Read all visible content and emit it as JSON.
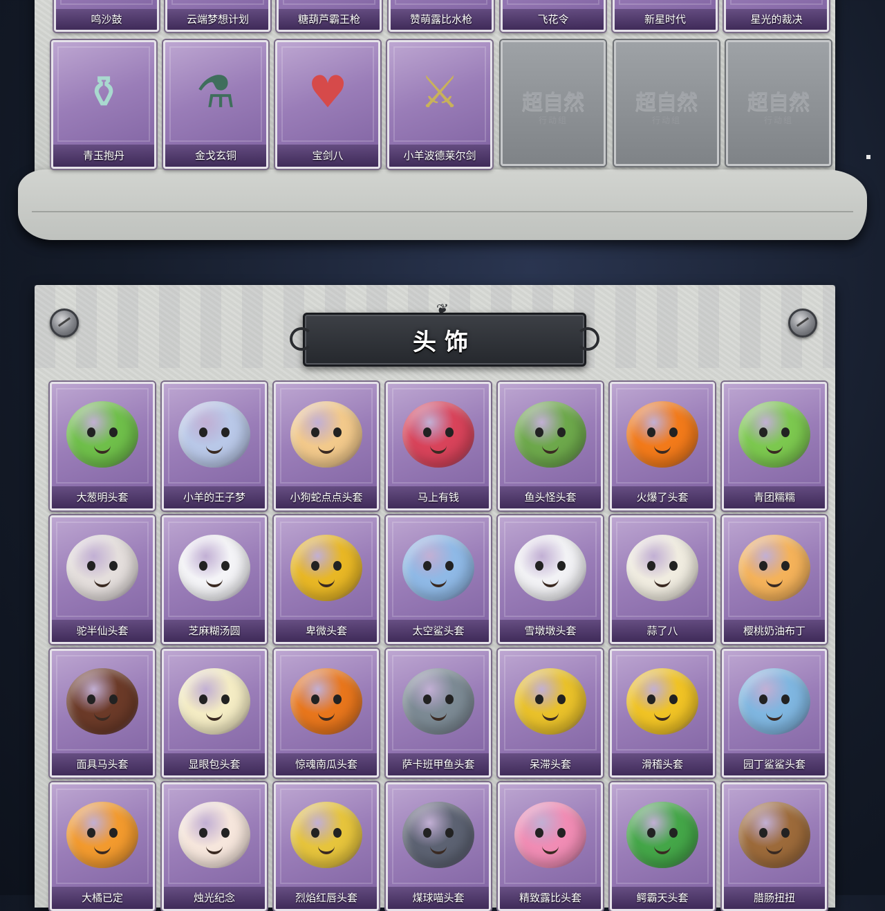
{
  "top_section": {
    "row1_labels": [
      "鸣沙鼓",
      "云端梦想计划",
      "糖葫芦霸王枪",
      "赞萌露比水枪",
      "飞花令",
      "新星时代",
      "星光的裁决"
    ],
    "row2_items": [
      {
        "label": "青玉抱丹",
        "icon": "jade-gourd-icon",
        "color": "#a9d9cf"
      },
      {
        "label": "金戈玄铜",
        "icon": "bronze-grenade-icon",
        "color": "#3f6e5c"
      },
      {
        "label": "宝剑八",
        "icon": "heart-shield-icon",
        "color": "#d64a4a"
      },
      {
        "label": "小羊波德莱尔剑",
        "icon": "sword-icon",
        "color": "#c9b25a"
      }
    ],
    "locked_cards": [
      {
        "text": "超自然",
        "sub": "行动组"
      },
      {
        "text": "超自然",
        "sub": "行动组"
      },
      {
        "text": "超自然",
        "sub": "行动组"
      }
    ]
  },
  "section_title": "头饰",
  "headwear": [
    [
      {
        "label": "大葱明头套",
        "icon": "scallion-head-icon",
        "color": "#6fbf4a"
      },
      {
        "label": "小羊的王子梦",
        "icon": "sheep-crown-head-icon",
        "color": "#b9c8e8"
      },
      {
        "label": "小狗蛇点点头套",
        "icon": "snake-head-icon",
        "color": "#f2c98b"
      },
      {
        "label": "马上有钱",
        "icon": "red-horse-head-icon",
        "color": "#d8435a"
      },
      {
        "label": "鱼头怪头套",
        "icon": "fish-head-icon",
        "color": "#6da84b"
      },
      {
        "label": "火爆了头套",
        "icon": "fire-head-icon",
        "color": "#f27a1a"
      },
      {
        "label": "青团糯糯",
        "icon": "green-dumpling-head-icon",
        "color": "#7cc84f"
      }
    ],
    [
      {
        "label": "驼半仙头套",
        "icon": "alpaca-sunglasses-head-icon",
        "color": "#e4dedc"
      },
      {
        "label": "芝麻糊汤圆",
        "icon": "rice-ball-head-icon",
        "color": "#f4f4f7"
      },
      {
        "label": "卑微头套",
        "icon": "sad-emoji-head-icon",
        "color": "#e8b725"
      },
      {
        "label": "太空鲨头套",
        "icon": "shark-head-icon",
        "color": "#8fb9e6"
      },
      {
        "label": "雪墩墩头套",
        "icon": "snowman-head-icon",
        "color": "#f2f2f5"
      },
      {
        "label": "蒜了八",
        "icon": "garlic-head-icon",
        "color": "#f0ece0"
      },
      {
        "label": "樱桃奶油布丁",
        "icon": "pudding-head-icon",
        "color": "#f4b25a"
      }
    ],
    [
      {
        "label": "面具马头套",
        "icon": "horse-mask-head-icon",
        "color": "#6b3a28"
      },
      {
        "label": "显眼包头套",
        "icon": "lightbulb-head-icon",
        "color": "#f4ecc4"
      },
      {
        "label": "惊魂南瓜头套",
        "icon": "pumpkin-head-icon",
        "color": "#e8761c"
      },
      {
        "label": "萨卡班甲鱼头套",
        "icon": "sacabambaspis-head-icon",
        "color": "#7c8a94"
      },
      {
        "label": "呆滞头套",
        "icon": "dazed-emoji-head-icon",
        "color": "#e9c12a"
      },
      {
        "label": "滑稽头套",
        "icon": "funny-emoji-head-icon",
        "color": "#f0c325"
      },
      {
        "label": "园丁鲨鲨头套",
        "icon": "gardener-shark-head-icon",
        "color": "#7fb6e0"
      }
    ],
    [
      {
        "label": "大橘已定",
        "icon": "orange-slice-head-icon",
        "color": "#f29a2e"
      },
      {
        "label": "烛光纪念",
        "icon": "candle-head-icon",
        "color": "#f6e6dc"
      },
      {
        "label": "烈焰红唇头套",
        "icon": "pikachu-sunglasses-head-icon",
        "color": "#e6c43c"
      },
      {
        "label": "煤球喵头套",
        "icon": "gray-cat-head-icon",
        "color": "#5c6272"
      },
      {
        "label": "精致露比头套",
        "icon": "pink-beaver-head-icon",
        "color": "#f08cb4"
      },
      {
        "label": "鳄霸天头套",
        "icon": "crocodile-head-icon",
        "color": "#44a648"
      },
      {
        "label": "腊肠扭扭",
        "icon": "dachshund-head-icon",
        "color": "#9c6a3a"
      }
    ]
  ]
}
